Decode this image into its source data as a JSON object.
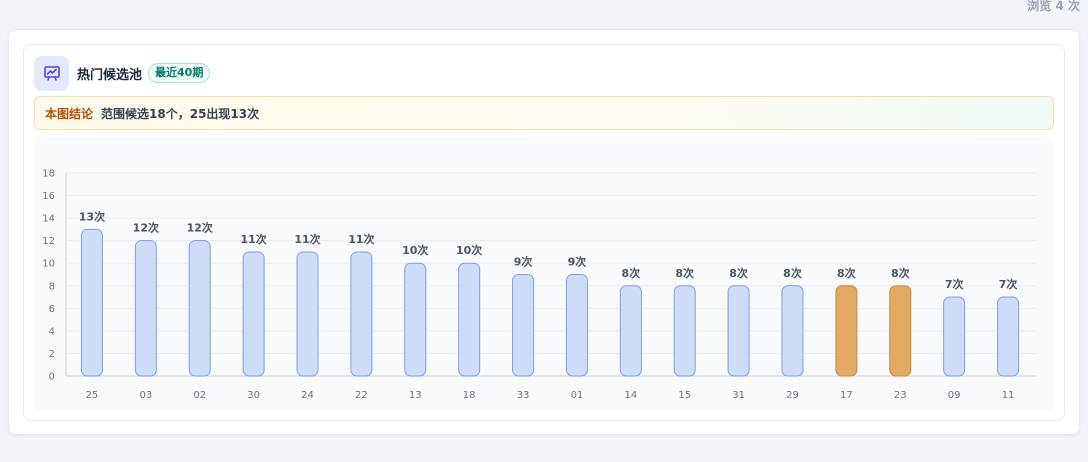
{
  "page": {
    "view_count": "浏览 4 次"
  },
  "card": {
    "icon": "trend-chart-icon",
    "title": "热门候选池",
    "badge": "最近40期",
    "conclusion_label": "本图结论",
    "conclusion_text": "范围候选18个，25出现13次"
  },
  "colors": {
    "bar_fill": "#cfdcf8",
    "bar_stroke": "#7f9fe0",
    "highlight_fill": "#e3a862",
    "highlight_stroke": "#c98a3c",
    "grid": "#e8ecf2",
    "axis": "#cdd3dc"
  },
  "chart_data": {
    "type": "bar",
    "categories": [
      "25",
      "03",
      "02",
      "30",
      "24",
      "22",
      "13",
      "18",
      "33",
      "01",
      "14",
      "15",
      "31",
      "29",
      "17",
      "23",
      "09",
      "11"
    ],
    "values": [
      13,
      12,
      12,
      11,
      11,
      11,
      10,
      10,
      9,
      9,
      8,
      8,
      8,
      8,
      8,
      8,
      7,
      7
    ],
    "labels": [
      "13次",
      "12次",
      "12次",
      "11次",
      "11次",
      "11次",
      "10次",
      "10次",
      "9次",
      "9次",
      "8次",
      "8次",
      "8次",
      "8次",
      "8次",
      "8次",
      "7次",
      "7次"
    ],
    "highlighted": [
      "17",
      "23"
    ],
    "ylim": [
      0,
      18
    ],
    "yticks": [
      0,
      2,
      4,
      6,
      8,
      10,
      12,
      14,
      16,
      18
    ],
    "yticks_labels": [
      "0",
      "2",
      "4",
      "6",
      "8",
      "10",
      "12",
      "14",
      "16",
      "18"
    ],
    "grid": true,
    "title": "",
    "xlabel": "",
    "ylabel": ""
  }
}
